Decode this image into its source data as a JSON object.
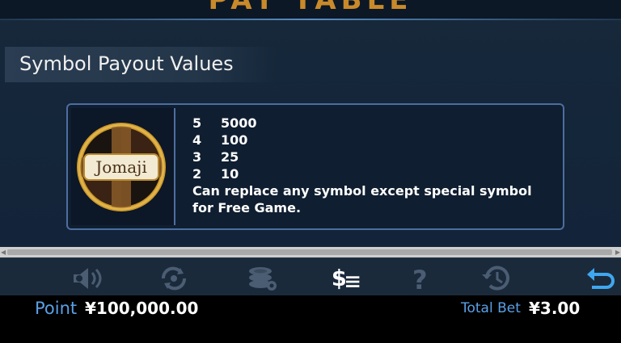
{
  "page": {
    "title_fragment": "PAY TABLE"
  },
  "section": {
    "title": "Symbol Payout Values"
  },
  "symbol": {
    "name": "Jomaji",
    "payouts": [
      {
        "count": "5",
        "value": "5000"
      },
      {
        "count": "4",
        "value": "100"
      },
      {
        "count": "3",
        "value": "25"
      },
      {
        "count": "2",
        "value": "10"
      }
    ],
    "description": "Can replace any symbol except special symbol for Free Game."
  },
  "toolbar": {
    "icons": [
      "sound-settings-icon",
      "autoplay-settings-icon",
      "bet-settings-icon",
      "paytable-icon",
      "help-icon",
      "history-icon",
      "back-icon"
    ],
    "active": "paytable-icon",
    "colors": {
      "inactive": "#4b5d73",
      "active": "#ffffff",
      "back": "#3fa7f0"
    }
  },
  "footer": {
    "point_label": "Point",
    "point_value": "¥100,000.00",
    "total_bet_label": "Total Bet",
    "total_bet_value": "¥3.00"
  }
}
